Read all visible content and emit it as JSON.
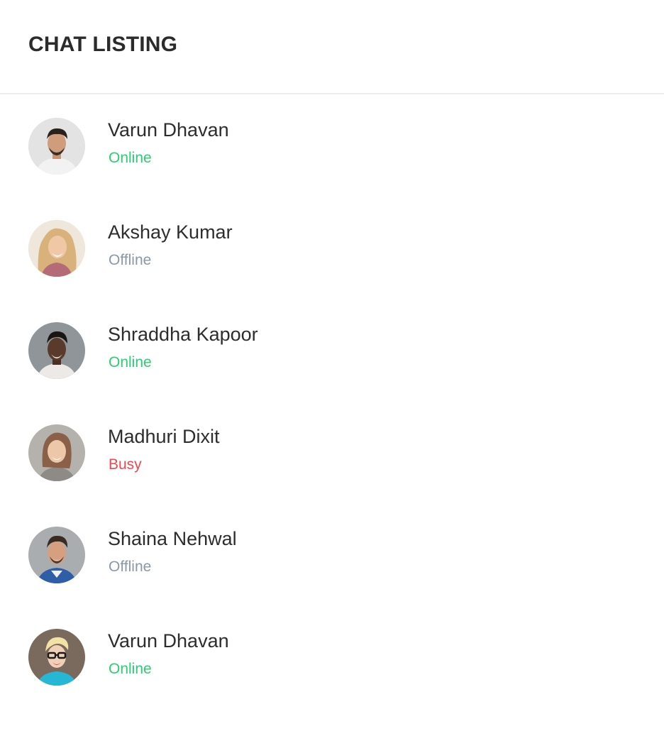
{
  "header": {
    "title": "CHAT LISTING"
  },
  "status_colors": {
    "Online": "#2ecc71",
    "Offline": "#8a98a8",
    "Busy": "#f0474e"
  },
  "contacts": [
    {
      "name": "Varun Dhavan",
      "status": "Online",
      "avatar_icon": "person-avatar-icon"
    },
    {
      "name": "Akshay Kumar",
      "status": "Offline",
      "avatar_icon": "person-avatar-icon"
    },
    {
      "name": "Shraddha Kapoor",
      "status": "Online",
      "avatar_icon": "person-avatar-icon"
    },
    {
      "name": "Madhuri Dixit",
      "status": "Busy",
      "avatar_icon": "person-avatar-icon"
    },
    {
      "name": "Shaina Nehwal",
      "status": "Offline",
      "avatar_icon": "person-avatar-icon"
    },
    {
      "name": "Varun Dhavan",
      "status": "Online",
      "avatar_icon": "person-avatar-icon"
    }
  ]
}
